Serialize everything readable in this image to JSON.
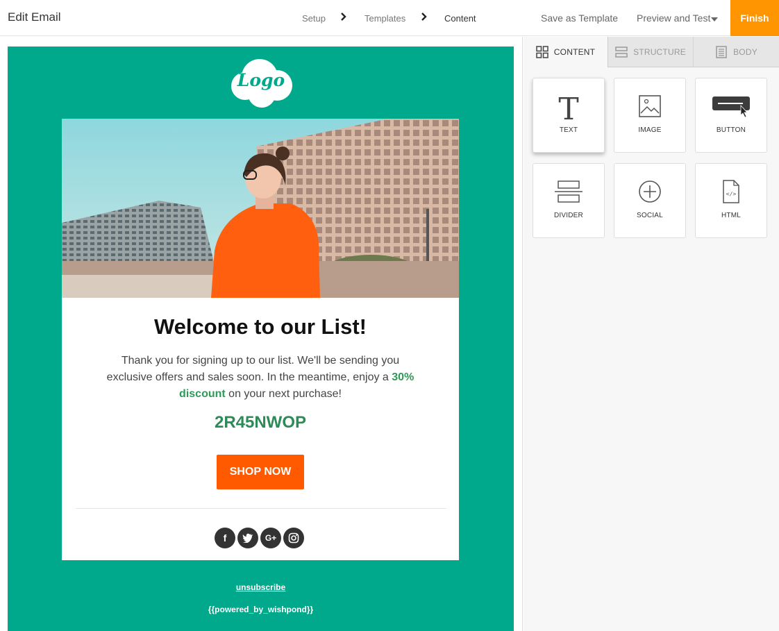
{
  "header": {
    "title": "Edit Email",
    "steps": [
      "Setup",
      "Templates",
      "Content"
    ],
    "save_template": "Save as Template",
    "preview": "Preview and Test",
    "finish": "Finish"
  },
  "email": {
    "logo": "Logo",
    "headline": "Welcome to our List!",
    "body_line1": "Thank you for signing up to our list. We'll be sending you exclusive offers and sales soon. In the meantime, enjoy a",
    "discount": "30% discount",
    "body_line2": "on your next purchase!",
    "code": "2R45NWOP",
    "cta": "SHOP NOW",
    "social_icons": [
      "facebook-icon",
      "twitter-icon",
      "google-plus-icon",
      "instagram-icon"
    ],
    "unsubscribe": "unsubscribe",
    "powered": "{{powered_by_wishpond}}"
  },
  "panel": {
    "tabs": [
      "CONTENT",
      "STRUCTURE",
      "BODY"
    ],
    "tiles": [
      "TEXT",
      "IMAGE",
      "BUTTON",
      "DIVIDER",
      "SOCIAL",
      "HTML"
    ]
  },
  "colors": {
    "email_bg": "#00a98c",
    "finish": "#ff9500",
    "cta": "#ff5a00",
    "code": "#2e8b57"
  }
}
